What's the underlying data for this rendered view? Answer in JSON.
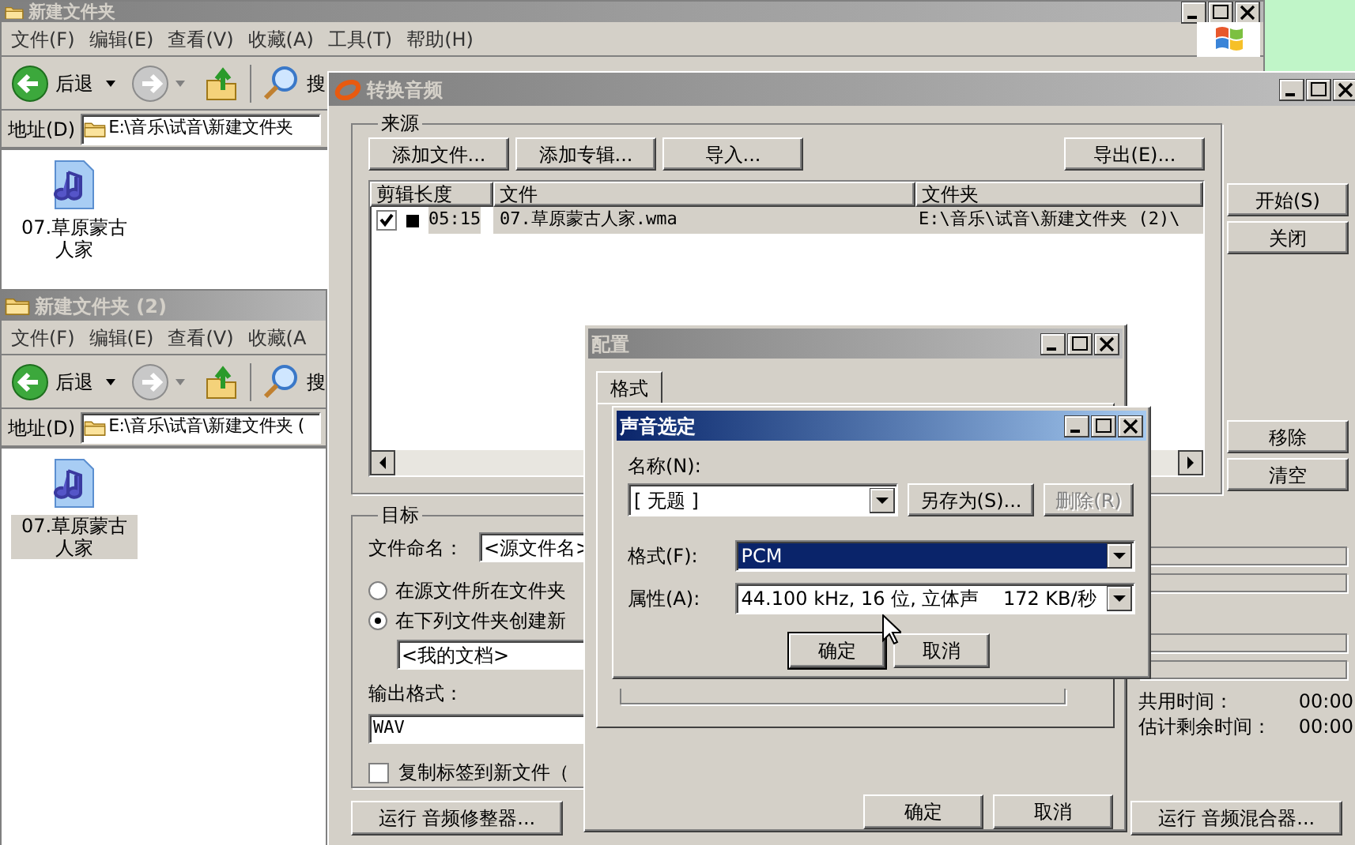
{
  "explorer_windows": [
    {
      "title": "新建文件夹",
      "menu": [
        "文件(F)",
        "编辑(E)",
        "查看(V)",
        "收藏(A)",
        "工具(T)",
        "帮助(H)"
      ],
      "back_label": "后退",
      "search_label": "搜",
      "address_label": "地址(D)",
      "address": "E:\\音乐\\试音\\新建文件夹",
      "file": {
        "name": "07.草原蒙古人家",
        "selected": false
      }
    },
    {
      "title": "新建文件夹 (2)",
      "menu": [
        "文件(F)",
        "编辑(E)",
        "查看(V)",
        "收藏(A"
      ],
      "back_label": "后退",
      "search_label": "搜",
      "address_label": "地址(D)",
      "address": "E:\\音乐\\试音\\新建文件夹 (",
      "file": {
        "name": "07.草原蒙古人家",
        "selected": true
      }
    }
  ],
  "convert_window": {
    "title": "转换音频",
    "source_group": "来源",
    "source_buttons": [
      "添加文件...",
      "添加专辑...",
      "导入..."
    ],
    "export_button": "导出(E)...",
    "columns": [
      "剪辑长度",
      "文件",
      "文件夹"
    ],
    "rows": [
      {
        "checked": true,
        "selected": true,
        "length": "05:15",
        "file": "07.草原蒙古人家.wma",
        "folder": "E:\\音乐\\试音\\新建文件夹 (2)\\"
      }
    ],
    "side_buttons_top": [
      "开始(S)",
      "关闭"
    ],
    "side_buttons_bottom": [
      "移除",
      "清空"
    ],
    "target_group": "目标",
    "naming_label": "文件命名：",
    "naming_value": "<源文件名>",
    "radios": [
      {
        "label": "在源文件所在文件夹",
        "selected": false
      },
      {
        "label": "在下列文件夹创建新",
        "selected": true
      }
    ],
    "folder_value": "<我的文档>",
    "output_label": "输出格式：",
    "output_value": "WAV",
    "copy_tags": {
      "label": "复制标签到新文件（",
      "checked": false
    },
    "times": [
      {
        "label": "共用时间：",
        "value": "00:00"
      },
      {
        "label": "估计剩余时间：",
        "value": "00:00"
      }
    ],
    "bottom_buttons": [
      "运行 音频修整器...",
      "运行 音频混合器..."
    ]
  },
  "config_dialog": {
    "title": "配置",
    "tabs": [
      {
        "label": "格式",
        "selected": true
      }
    ],
    "buttons": [
      "确定",
      "取消"
    ]
  },
  "sound_dialog": {
    "title": "声音选定",
    "name_label": "名称(N):",
    "name_value": "[ 无题 ]",
    "save_as": "另存为(S)...",
    "delete": {
      "label": "删除(R)",
      "disabled": true
    },
    "format_label": "格式(F):",
    "format_value": "PCM",
    "format_highlighted": true,
    "attr_label": "属性(A):",
    "attr_value": "44.100 kHz, 16 位, 立体声    172 KB/秒",
    "buttons": [
      "确定",
      "取消"
    ]
  }
}
